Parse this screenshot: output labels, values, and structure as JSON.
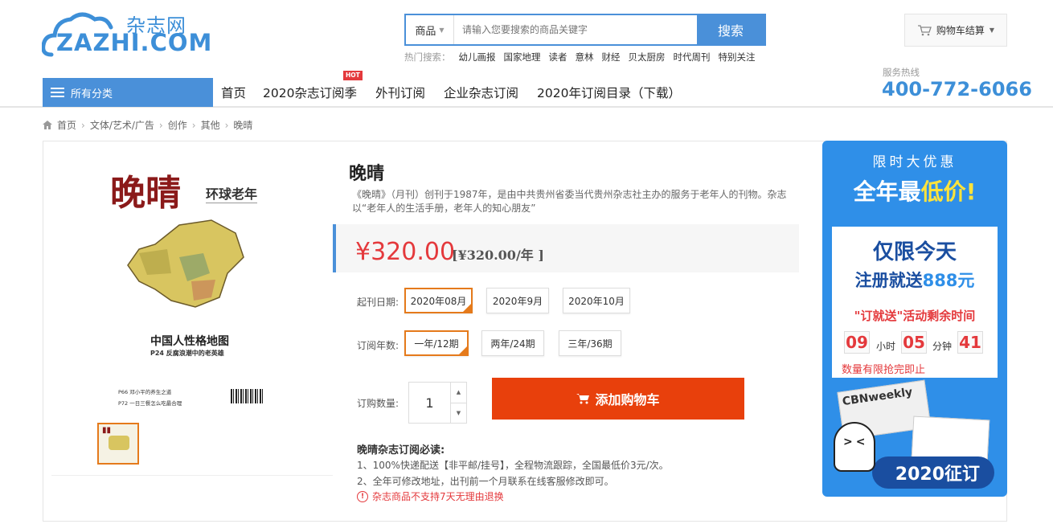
{
  "logo": {
    "cn": "杂志网",
    "en": "ZAZHI.COM"
  },
  "search": {
    "category": "商品",
    "placeholder": "请输入您要搜索的商品关键字",
    "button": "搜索",
    "hot_label": "热门搜索：",
    "hot": [
      "幼儿画报",
      "国家地理",
      "读者",
      "意林",
      "财经",
      "贝太厨房",
      "时代周刊",
      "特别关注"
    ]
  },
  "cart": {
    "label": "购物车结算"
  },
  "hotline": {
    "label": "服务热线",
    "number": "400-772-6066"
  },
  "nav": {
    "all": "所有分类",
    "items": [
      "首页",
      "2020杂志订阅季",
      "外刊订阅",
      "企业杂志订阅",
      "2020年订阅目录（下载）"
    ],
    "hot_badge": "HOT"
  },
  "breadcrumb": [
    "首页",
    "文体/艺术/广告",
    "创作",
    "其他",
    "晚晴"
  ],
  "product": {
    "title": "晚晴",
    "desc": "《晚晴》（月刊）创刊于1987年，是由中共贵州省委当代贵州杂志社主办的服务于老年人的刊物。杂志以“老年人的生活手册，老年人的知心朋友”",
    "price": "¥320.00",
    "price_year": "[¥320.00/年 ]",
    "start_label": "起刊日期:",
    "start_options": [
      "2020年08月",
      "2020年9月",
      "2020年10月"
    ],
    "years_label": "订阅年数:",
    "years_options": [
      "一年/12期",
      "两年/24期",
      "三年/36期"
    ],
    "qty_label": "订购数量:",
    "qty": "1",
    "add_cart": "添加购物车",
    "notice_title": "晚晴杂志订阅必读:",
    "notice1": "1、100%快递配送【非平邮/挂号】，全程物流跟踪，全国最低价3元/次。",
    "notice2": "2、全年可修改地址，出刊前一个月联系在线客服修改即可。",
    "warn": "杂志商品不支持7天无理由退换"
  },
  "cover": {
    "title": "晚晴",
    "sub": "环球老年",
    "map_title": "中国人性格地图",
    "line1": "P24 反腐浪潮中的老英雄",
    "line2": "P66 邓小平的养生之道",
    "line3": "P72 一日三餐怎么吃最合理"
  },
  "ad": {
    "top": "限时大优惠",
    "big1": "全年最",
    "big2": "低价!",
    "l1": "仅限今天",
    "l2a": "注册就送",
    "l2b": "888元",
    "l3": "\"订就送\"活动剩余时间",
    "hours": "09",
    "hours_u": "小时",
    "mins": "05",
    "mins_u": "分钟",
    "secs": "41",
    "l4": "数量有限抢完即止",
    "paper": "CBNweekly",
    "pill": "2020征订"
  }
}
